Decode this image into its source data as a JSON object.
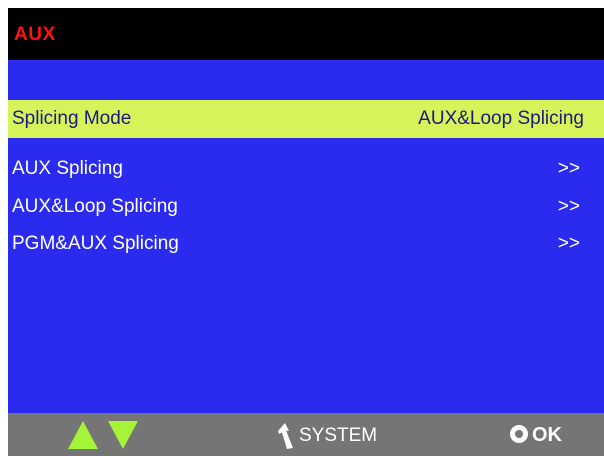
{
  "header": {
    "title": "AUX"
  },
  "menu": {
    "selected": {
      "label": "Splicing Mode",
      "value": "AUX&Loop Splicing"
    },
    "items": [
      {
        "label": "AUX Splicing",
        "arrow": ">>"
      },
      {
        "label": "AUX&Loop Splicing",
        "arrow": ">>"
      },
      {
        "label": "PGM&AUX Splicing",
        "arrow": ">>"
      }
    ]
  },
  "footer": {
    "nav_icons": [
      "up-arrow-icon",
      "down-arrow-icon"
    ],
    "back_icon": "back-arrow-icon",
    "system_label": "SYSTEM",
    "ok_icon": "ok-circle-icon",
    "ok_label": "OK"
  },
  "colors": {
    "background": "#2b2bf0",
    "titlebar": "#000000",
    "title_text": "#ff1111",
    "selected_row": "#d6f45a",
    "footer": "#757575",
    "arrow": "#a6f43a"
  }
}
